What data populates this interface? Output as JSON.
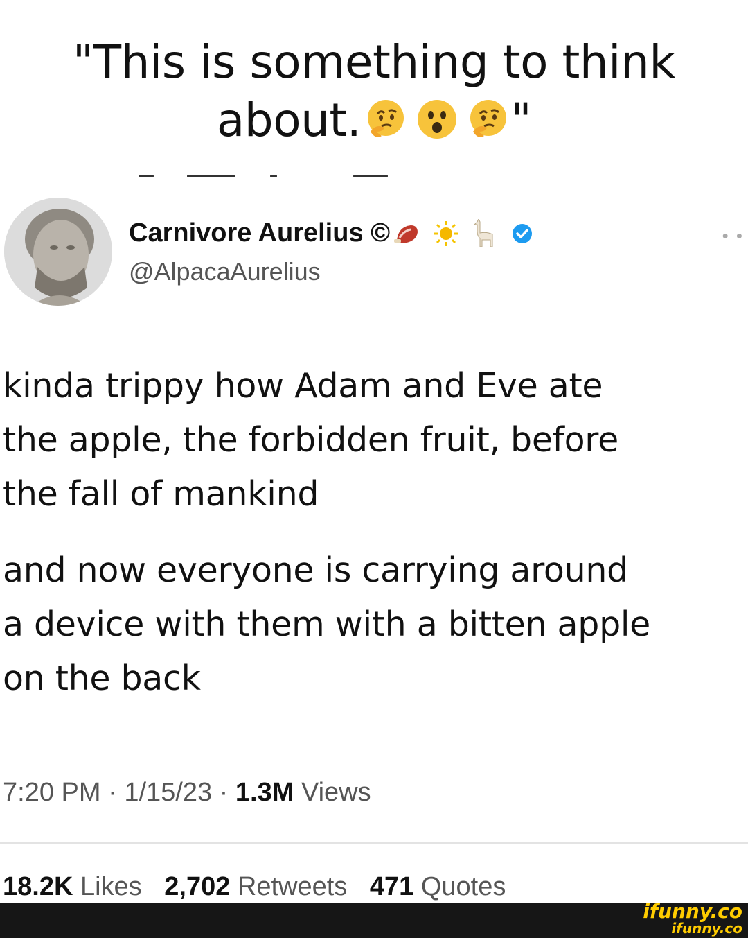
{
  "caption": {
    "text": "\"This is something to think about.",
    "closing_quote": "\"",
    "emoji_icons": [
      "thinking-face",
      "hushed-face",
      "thinking-face"
    ]
  },
  "tweet": {
    "display_name": "Carnivore Aurelius ©",
    "name_badges": [
      "meat-icon",
      "sun-icon",
      "llama-icon",
      "verified-badge-icon"
    ],
    "handle": "@AlpacaAurelius",
    "more_icon": "more-dots-icon",
    "paragraph_1": "kinda trippy how Adam and Eve ate\nthe apple, the forbidden fruit, before\nthe fall of mankind",
    "paragraph_2": "and now everyone is carrying around\na device with them with a bitten apple\non the back",
    "time": "7:20 PM",
    "date": "1/15/23",
    "separator": "·",
    "views_count": "1.3M",
    "views_label": "Views",
    "likes_count": "18.2K",
    "likes_label": "Likes",
    "retweets_count": "2,702",
    "retweets_label": "Retweets",
    "quotes_count": "471",
    "quotes_label": "Quotes"
  },
  "watermark": {
    "primary": "ifunny.co",
    "secondary": "ifunny.co"
  },
  "colors": {
    "background": "#ffffff",
    "text": "#111111",
    "muted": "#555555",
    "verified": "#1d9bf0",
    "watermark": "#ffcc00",
    "footer": "#161616"
  }
}
